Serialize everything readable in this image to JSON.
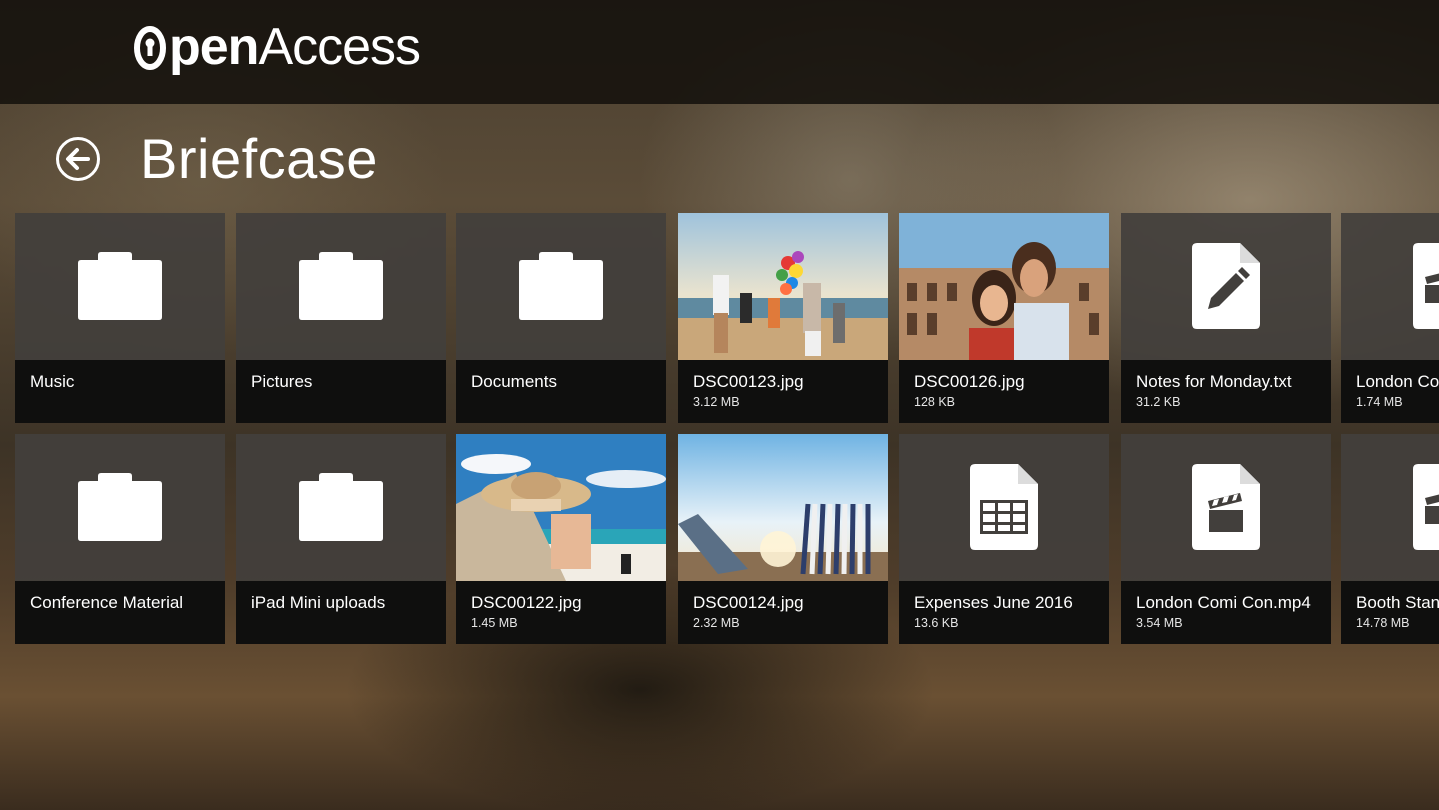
{
  "app": {
    "brand_first": "O",
    "brand_pen": "pen",
    "brand_access": "Access"
  },
  "page": {
    "title": "Briefcase",
    "back_icon": "back-arrow-circle-icon"
  },
  "items": [
    {
      "name": "Music",
      "size": "",
      "kind": "folder"
    },
    {
      "name": "Pictures",
      "size": "",
      "kind": "folder"
    },
    {
      "name": "Documents",
      "size": "",
      "kind": "folder"
    },
    {
      "name": "DSC00123.jpg",
      "size": "3.12 MB",
      "kind": "photo-beach-balloons"
    },
    {
      "name": "DSC00126.jpg",
      "size": "128 KB",
      "kind": "photo-colosseum-couple"
    },
    {
      "name": "Notes for Monday.txt",
      "size": "31.2 KB",
      "kind": "text-file"
    },
    {
      "name": "London Co",
      "size": "1.74 MB",
      "kind": "video-file"
    },
    {
      "name": "Conference Material",
      "size": "",
      "kind": "folder"
    },
    {
      "name": "iPad Mini uploads",
      "size": "",
      "kind": "folder"
    },
    {
      "name": "DSC00122.jpg",
      "size": "1.45 MB",
      "kind": "photo-beach-hat"
    },
    {
      "name": "DSC00124.jpg",
      "size": "2.32 MB",
      "kind": "photo-deck-chairs"
    },
    {
      "name": "Expenses June 2016",
      "size": "13.6 KB",
      "kind": "spreadsheet-file"
    },
    {
      "name": "London Comi Con.mp4",
      "size": "3.54 MB",
      "kind": "video-file"
    },
    {
      "name": "Booth Stan",
      "size": "14.78 MB",
      "kind": "video-file"
    }
  ],
  "colors": {
    "tile_bg": "#423f3c",
    "caption_bg": "#0a0a0a",
    "text": "#ffffff"
  }
}
